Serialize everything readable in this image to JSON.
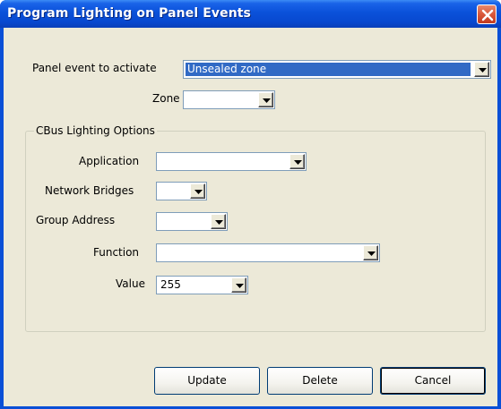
{
  "window": {
    "title": "Program Lighting on Panel Events",
    "close_icon": "close-icon"
  },
  "form": {
    "panel_event_label": "Panel event to activate",
    "panel_event_value": "Unsealed zone",
    "zone_label": "Zone",
    "zone_value": ""
  },
  "cbus": {
    "group_title": "CBus Lighting Options",
    "application_label": "Application",
    "application_value": "",
    "network_bridges_label": "Network Bridges",
    "network_bridges_value": "",
    "group_address_label": "Group Address",
    "group_address_value": "",
    "function_label": "Function",
    "function_value": "",
    "value_label": "Value",
    "value_value": "255"
  },
  "buttons": {
    "update": "Update",
    "delete": "Delete",
    "cancel": "Cancel"
  },
  "colors": {
    "titlebar": "#0a4fd6",
    "client_bg": "#ece9d8",
    "selection": "#316ac5",
    "close_button": "#d9573a"
  }
}
